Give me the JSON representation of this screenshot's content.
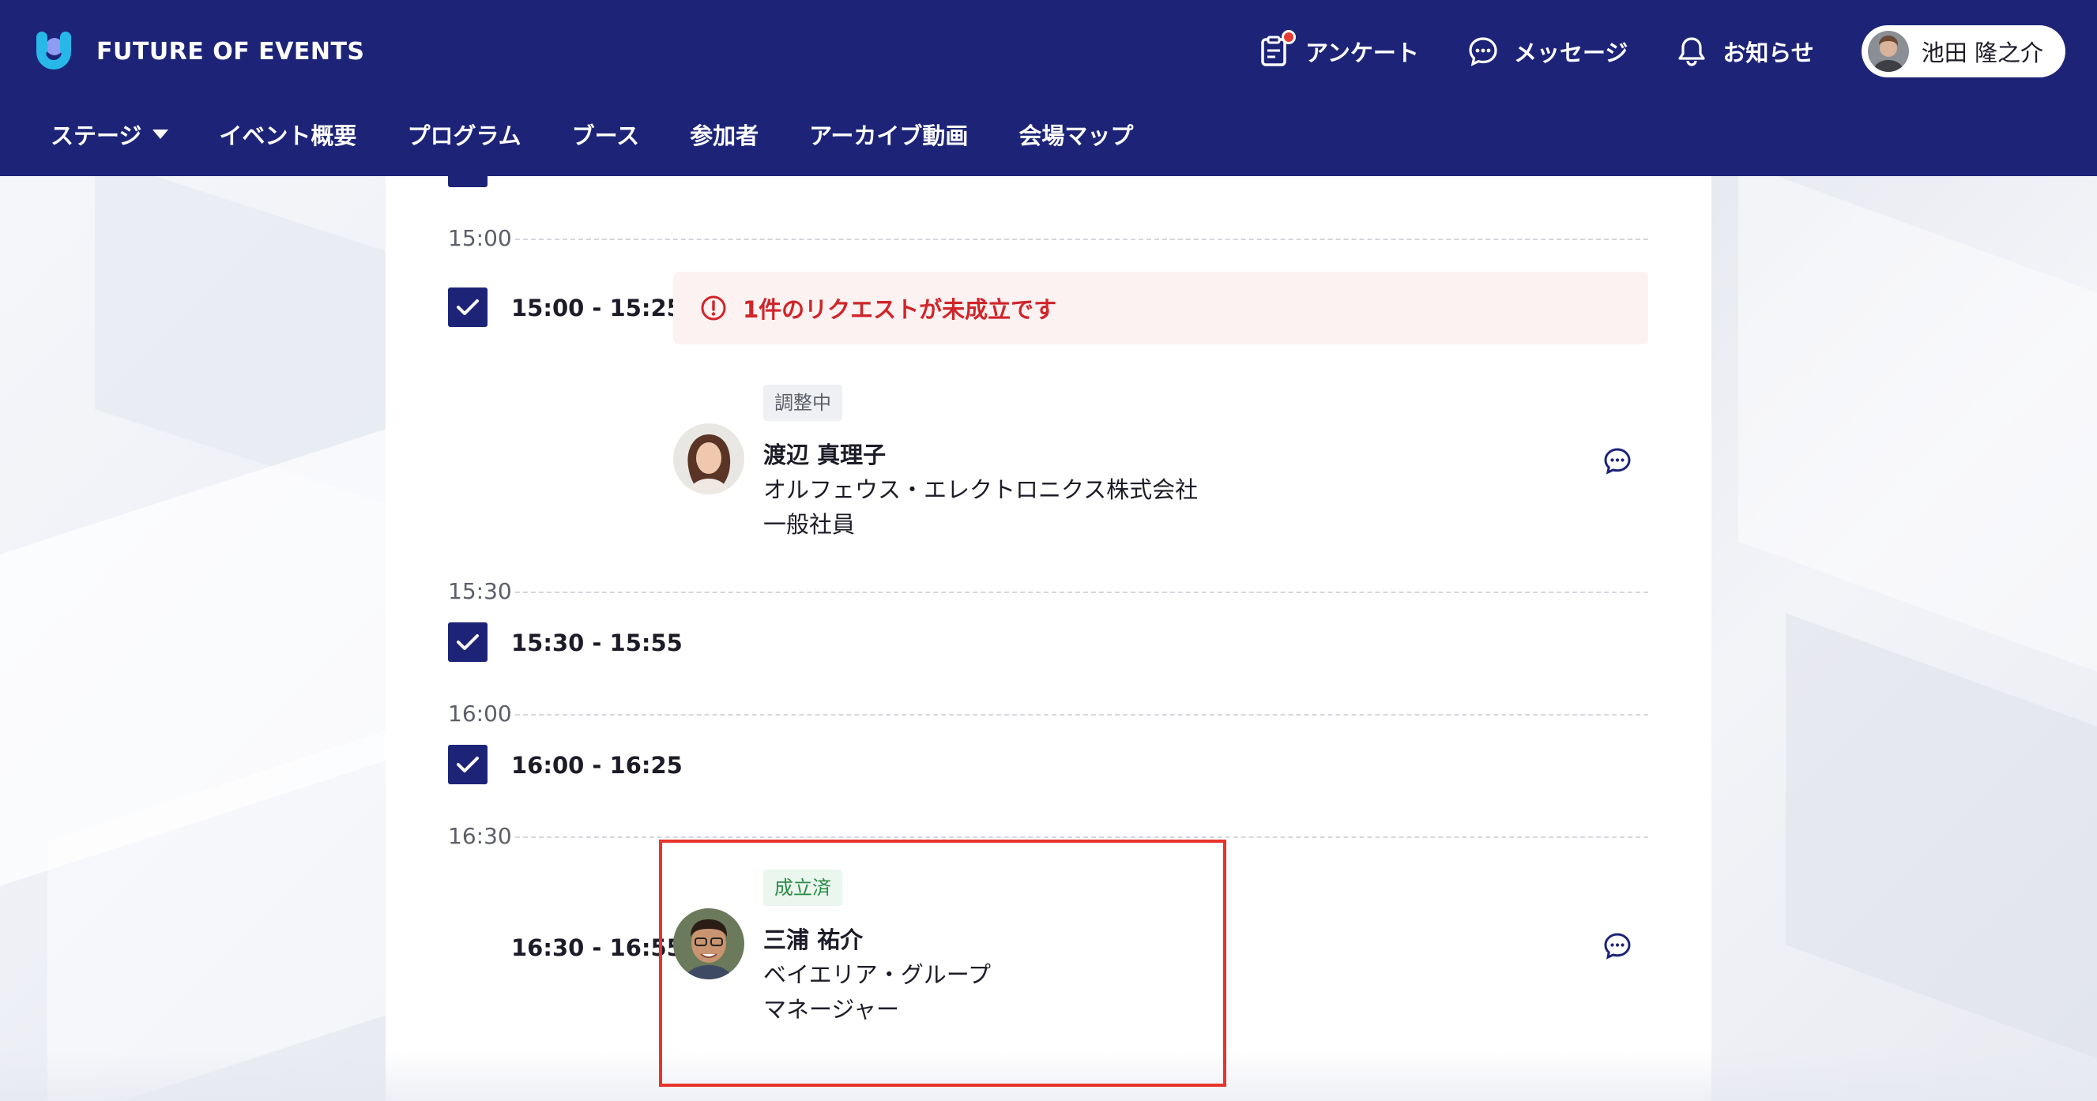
{
  "header": {
    "brand": "FUTURE OF EVENTS",
    "actions": [
      {
        "label": "アンケート",
        "icon": "survey-icon",
        "has_notification": true
      },
      {
        "label": "メッセージ",
        "icon": "message-icon"
      },
      {
        "label": "お知らせ",
        "icon": "bell-icon"
      }
    ],
    "user_name": "池田 隆之介"
  },
  "nav": {
    "items": [
      {
        "label": "ステージ",
        "has_dropdown": true
      },
      {
        "label": "イベント概要"
      },
      {
        "label": "プログラム"
      },
      {
        "label": "ブース"
      },
      {
        "label": "参加者"
      },
      {
        "label": "アーカイブ動画"
      },
      {
        "label": "会場マップ"
      }
    ]
  },
  "schedule": {
    "time_labels": [
      "15:00",
      "15:30",
      "16:00",
      "16:30"
    ],
    "slots": [
      {
        "range": "15:00 - 15:25",
        "checked": true
      },
      {
        "range": "15:30 - 15:55",
        "checked": true
      },
      {
        "range": "16:00 - 16:25",
        "checked": true
      },
      {
        "range": "16:30 - 16:55",
        "checked": false
      }
    ],
    "alert": "1件のリクエストが未成立です",
    "meetings": [
      {
        "status": "調整中",
        "name": "渡辺 真理子",
        "company": "オルフェウス・エレクトロニクス株式会社",
        "title": "一般社員"
      },
      {
        "status": "成立済",
        "name": "三浦 祐介",
        "company": "ベイエリア・グループ",
        "title": "マネージャー"
      }
    ]
  },
  "colors": {
    "header_bg": "#1d2478",
    "accent": "#1d2478",
    "alert_text": "#d0252a",
    "done_badge": "#2a8a46",
    "highlight_border": "#e8342b"
  }
}
